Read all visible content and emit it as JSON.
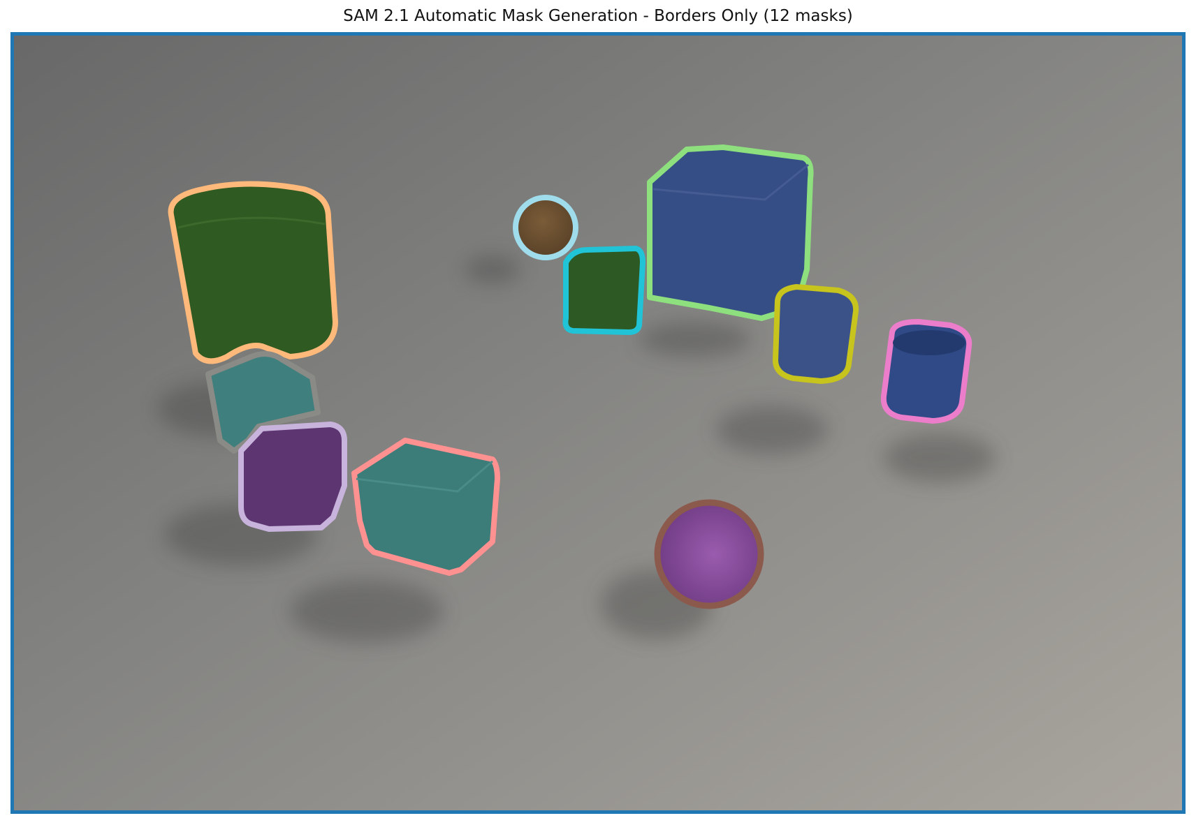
{
  "title": "SAM 2.1 Automatic Mask Generation - Borders Only (12 masks)",
  "colors": {
    "frame_border": "#1f77b4",
    "background_light": "#a39f98",
    "background_dark": "#696969"
  },
  "masks": [
    {
      "object": "green-cylinder",
      "fill": "#2f5a22",
      "border": "#ffb97a"
    },
    {
      "object": "teal-cube-small",
      "fill": "#3f7f7d",
      "border": "#8a8a86"
    },
    {
      "object": "purple-cube",
      "fill": "#5d3671",
      "border": "#c8b3dc"
    },
    {
      "object": "teal-cube-large",
      "fill": "#3c7c79",
      "border": "#ff9191"
    },
    {
      "object": "brown-sphere",
      "fill": "#6d5232",
      "border": "#9fdcec"
    },
    {
      "object": "green-cube-small",
      "fill": "#2d5a24",
      "border": "#21c3d6"
    },
    {
      "object": "blue-cube-large",
      "fill": "#354e86",
      "border": "#8ee07e"
    },
    {
      "object": "blue-cylinder-left",
      "fill": "#3a5288",
      "border": "#c7c41e"
    },
    {
      "object": "blue-cylinder-right",
      "fill": "#2f4a86",
      "border": "#ec7dcb"
    },
    {
      "object": "purple-sphere",
      "fill": "#8a4c9e",
      "border": "#8b5a4c"
    }
  ]
}
